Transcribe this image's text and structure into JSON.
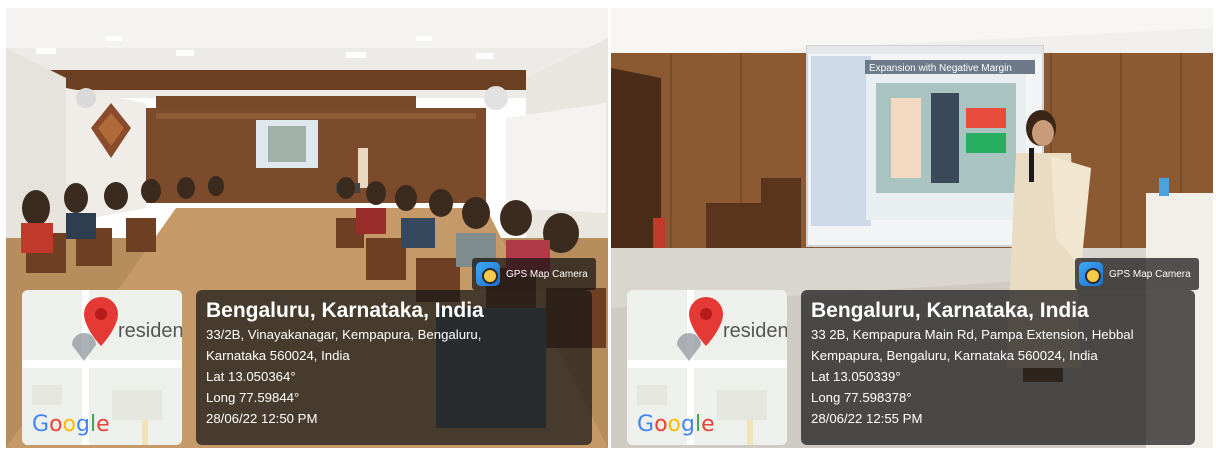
{
  "photos": [
    {
      "badge": "GPS Map Camera",
      "map_label": "residen",
      "google_logo": {
        "g1": "G",
        "o1": "o",
        "o2": "o",
        "g2": "g",
        "l": "l",
        "e": "e"
      },
      "location_title": "Bengaluru, Karnataka, India",
      "address_line1": "33/2B, Vinayakanagar, Kempapura, Bengaluru,",
      "address_line2": "Karnataka 560024, India",
      "lat": "Lat 13.050364°",
      "long": "Long 77.59844°",
      "datetime": "28/06/22 12:50 PM"
    },
    {
      "badge": "GPS Map Camera",
      "map_label": "residen",
      "google_logo": {
        "g1": "G",
        "o1": "o",
        "o2": "o",
        "g2": "g",
        "l": "l",
        "e": "e"
      },
      "location_title": "Bengaluru, Karnataka, India",
      "address_line1": "33 2B, Kempapura Main Rd, Pampa Extension, Hebbal",
      "address_line2": "Kempapura, Bengaluru, Karnataka 560024, India",
      "lat": "Lat 13.050339°",
      "long": "Long 77.598378°",
      "datetime": "28/06/22 12:55 PM"
    }
  ],
  "slide_title": "Expansion with Negative Margin",
  "colors": {
    "map_pin": "#e53935",
    "overlay": "#161616"
  }
}
